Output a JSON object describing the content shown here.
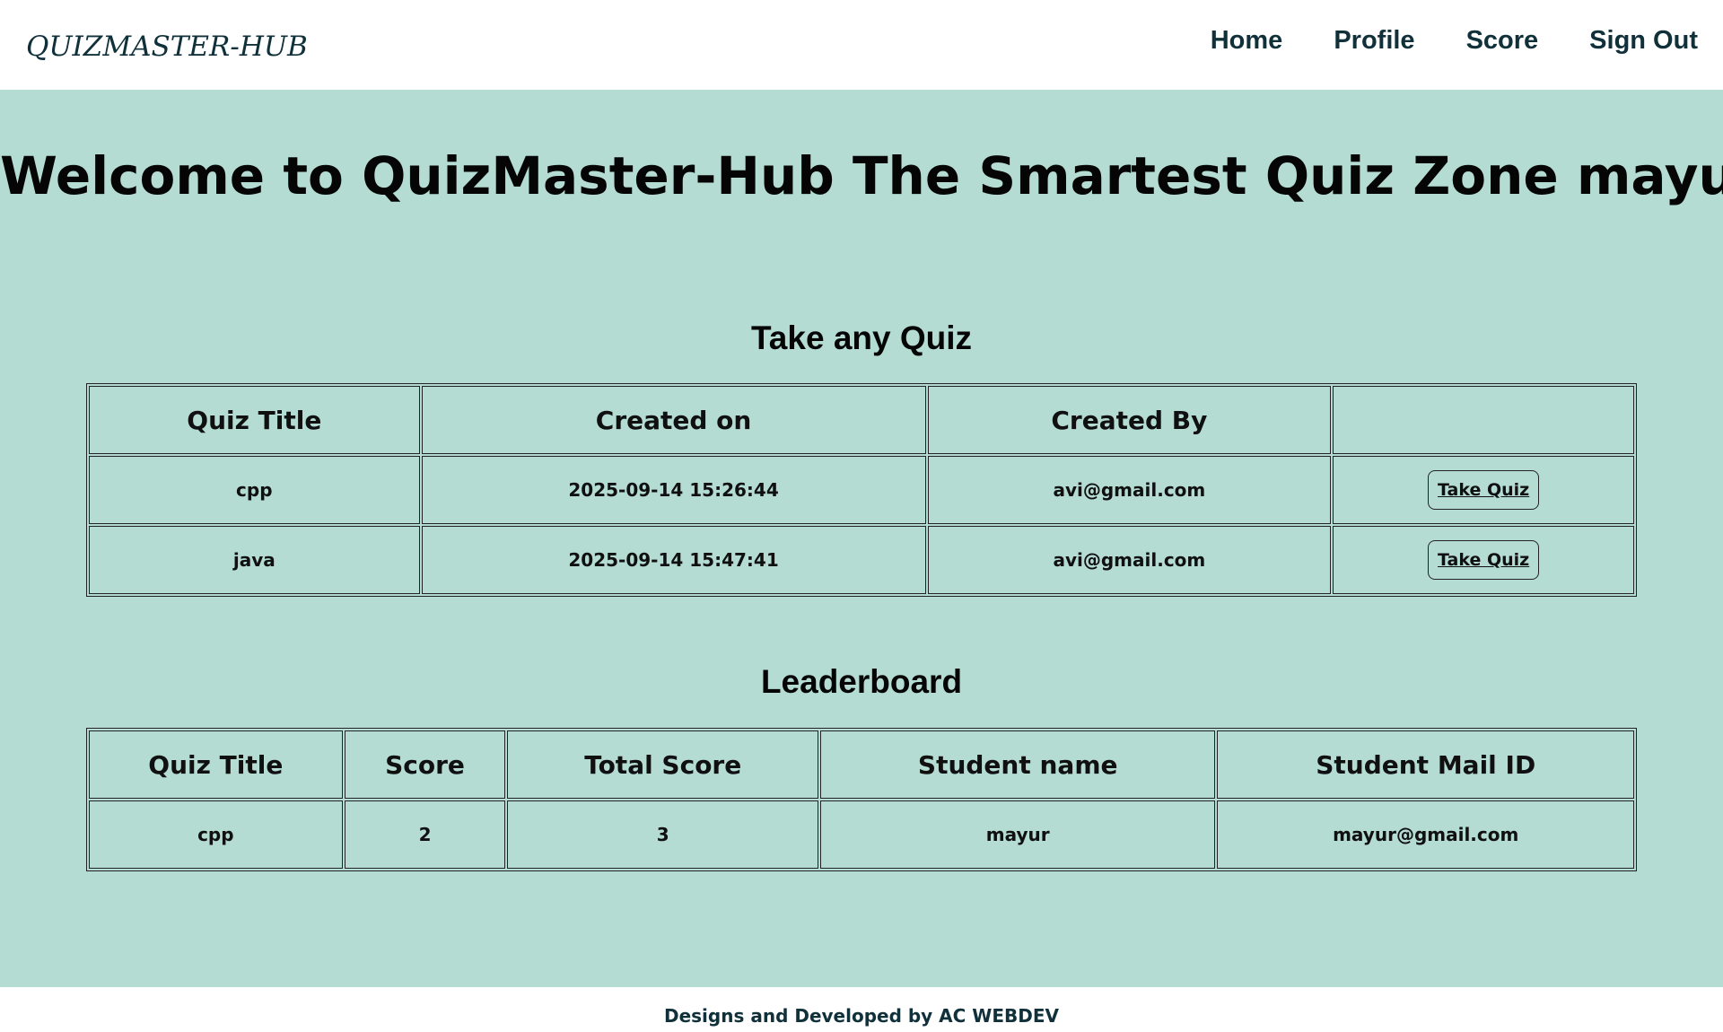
{
  "navbar": {
    "brand": "QUIZMASTER-HUB",
    "links": [
      "Home",
      "Profile",
      "Score",
      "Sign Out"
    ]
  },
  "welcome": "Welcome to QuizMaster-Hub The Smartest Quiz Zone  mayur!",
  "quiz_section": {
    "title": "Take any Quiz",
    "headers": [
      "Quiz Title",
      "Created on",
      "Created By",
      ""
    ],
    "rows": [
      {
        "title": "cpp",
        "created_on": "2025-09-14 15:26:44",
        "created_by": "avi@gmail.com",
        "action": "Take Quiz"
      },
      {
        "title": "java",
        "created_on": "2025-09-14 15:47:41",
        "created_by": "avi@gmail.com",
        "action": "Take Quiz"
      }
    ]
  },
  "leaderboard": {
    "title": "Leaderboard",
    "headers": [
      "Quiz Title",
      "Score",
      "Total Score",
      "Student name",
      "Student Mail ID"
    ],
    "rows": [
      {
        "quiz_title": "cpp",
        "score": "2",
        "total_score": "3",
        "student_name": "mayur",
        "student_mail": "mayur@gmail.com"
      }
    ]
  },
  "footer": "Designs and Developed by AC WEBDEV"
}
